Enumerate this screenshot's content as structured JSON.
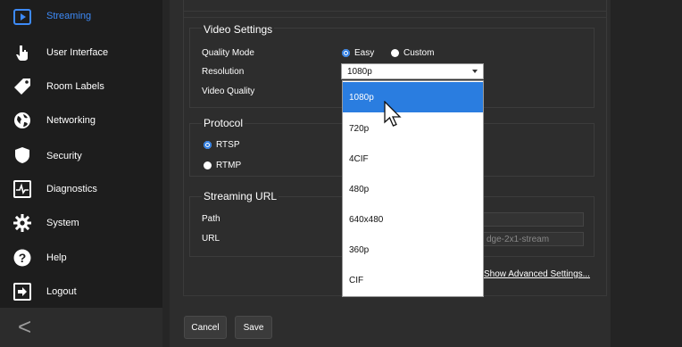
{
  "sidebar": {
    "items": [
      {
        "label": "Streaming",
        "icon": "play-icon",
        "active": true
      },
      {
        "label": "User Interface",
        "icon": "hand-pointer-icon"
      },
      {
        "label": "Room Labels",
        "icon": "tag-icon"
      },
      {
        "label": "Networking",
        "icon": "globe-icon"
      },
      {
        "label": "Security",
        "icon": "shield-icon"
      },
      {
        "label": "Diagnostics",
        "icon": "pulse-icon"
      },
      {
        "label": "System",
        "icon": "gear-icon"
      },
      {
        "label": "Help",
        "icon": "question-icon"
      },
      {
        "label": "Logout",
        "icon": "logout-icon"
      }
    ],
    "collapse_glyph": "<"
  },
  "video_settings": {
    "title": "Video Settings",
    "quality_mode_label": "Quality Mode",
    "quality_options": [
      "Easy",
      "Custom"
    ],
    "quality_selected": "Easy",
    "resolution_label": "Resolution",
    "resolution_value": "1080p",
    "video_quality_label": "Video Quality"
  },
  "resolution_dropdown": {
    "options": [
      "1080p",
      "720p",
      "4CIF",
      "480p",
      "640x480",
      "360p",
      "CIF"
    ],
    "highlighted": "1080p"
  },
  "protocol": {
    "title": "Protocol",
    "options": [
      "RTSP",
      "RTMP"
    ],
    "selected": "RTSP"
  },
  "streaming_url": {
    "title": "Streaming URL",
    "path_label": "Path",
    "url_label": "URL",
    "url_value_visible": "dge-2x1-stream"
  },
  "advanced_link": "Show Advanced Settings...",
  "buttons": {
    "cancel": "Cancel",
    "save": "Save"
  },
  "colors": {
    "accent": "#2a7de0",
    "sidebar_bg": "#1d1d1d",
    "panel_bg": "#2d2d2d"
  }
}
